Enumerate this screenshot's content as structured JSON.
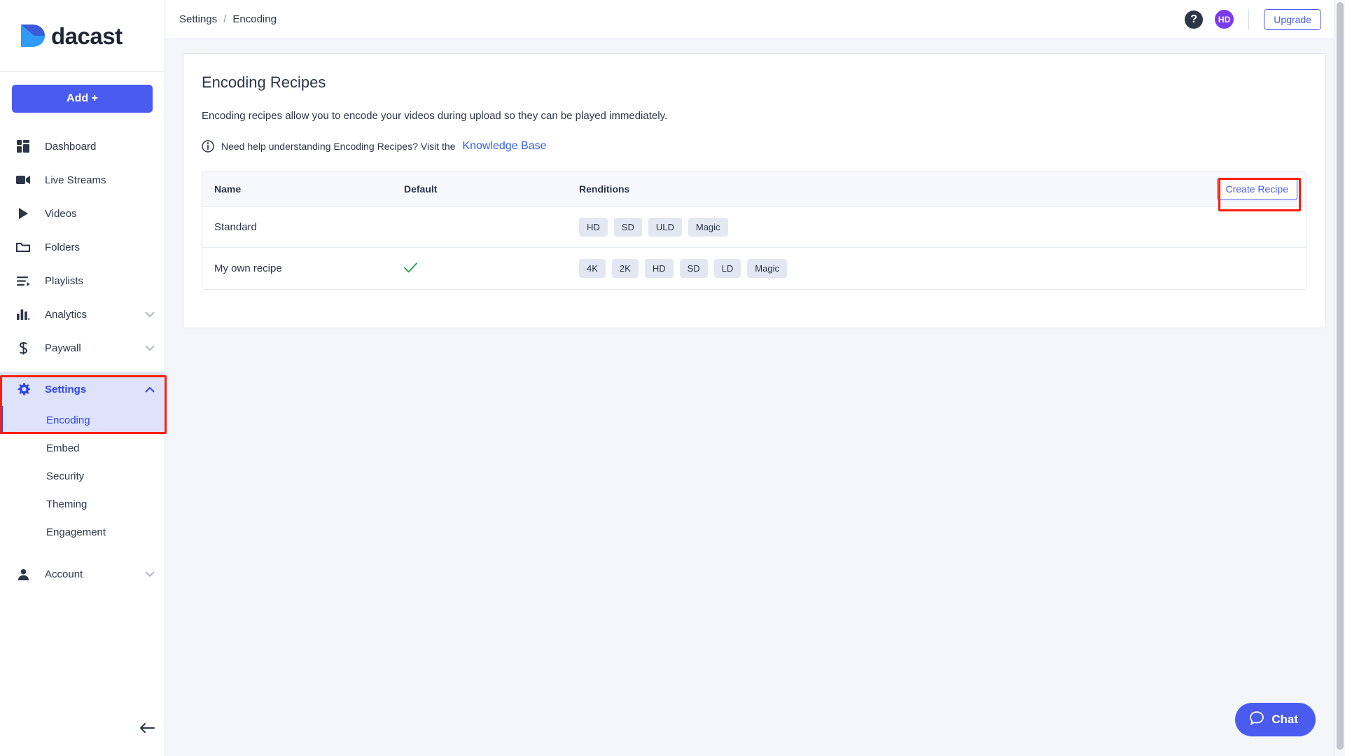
{
  "brand": {
    "name": "dacast",
    "accent": "#4a5bf0",
    "logo_icon": "dacast-logo-mark"
  },
  "sidebar": {
    "add_button": "Add +",
    "items": [
      {
        "label": "Dashboard",
        "icon": "dashboard-icon",
        "expandable": false
      },
      {
        "label": "Live Streams",
        "icon": "video-camera-icon",
        "expandable": false
      },
      {
        "label": "Videos",
        "icon": "play-icon",
        "expandable": false
      },
      {
        "label": "Folders",
        "icon": "folder-icon",
        "expandable": false
      },
      {
        "label": "Playlists",
        "icon": "playlist-icon",
        "expandable": false
      },
      {
        "label": "Analytics",
        "icon": "bar-chart-icon",
        "expandable": true,
        "chevron": "chevron-down-icon"
      },
      {
        "label": "Paywall",
        "icon": "dollar-icon",
        "expandable": true,
        "chevron": "chevron-down-icon"
      }
    ],
    "settings": {
      "label": "Settings",
      "icon": "gear-icon",
      "chevron": "chevron-up-icon",
      "expanded": true,
      "active": true,
      "sub_items": [
        {
          "label": "Encoding",
          "selected": true
        },
        {
          "label": "Embed",
          "selected": false
        },
        {
          "label": "Security",
          "selected": false
        },
        {
          "label": "Theming",
          "selected": false
        },
        {
          "label": "Engagement",
          "selected": false
        }
      ]
    },
    "account": {
      "label": "Account",
      "icon": "person-icon",
      "chevron": "chevron-down-icon"
    },
    "collapse_icon": "arrow-left-icon"
  },
  "topbar": {
    "breadcrumb": {
      "parent": "Settings",
      "separator": "/",
      "current": "Encoding"
    },
    "help_icon": "question-mark-icon",
    "avatar_initials": "HD",
    "avatar_color": "#7c3aed",
    "upgrade_label": "Upgrade"
  },
  "main": {
    "title": "Encoding Recipes",
    "description": "Encoding recipes allow you to encode your videos during upload so they can be played immediately.",
    "help_icon": "info-icon",
    "help_text": "Need help understanding Encoding Recipes? Visit the",
    "help_link": "Knowledge Base",
    "table": {
      "columns": [
        "Name",
        "Default",
        "Renditions"
      ],
      "create_button": "Create Recipe",
      "rows": [
        {
          "name": "Standard",
          "is_default": false,
          "default_icon": "",
          "renditions": [
            "HD",
            "SD",
            "ULD",
            "Magic"
          ]
        },
        {
          "name": "My own recipe",
          "is_default": true,
          "default_icon": "check-icon",
          "renditions": [
            "4K",
            "2K",
            "HD",
            "SD",
            "LD",
            "Magic"
          ]
        }
      ]
    }
  },
  "chat": {
    "label": "Chat",
    "icon": "chat-bubble-icon"
  },
  "annotations": {
    "highlight_color": "#fb1f0c",
    "boxes": [
      "settings-encoding-nav",
      "create-recipe-button"
    ]
  }
}
